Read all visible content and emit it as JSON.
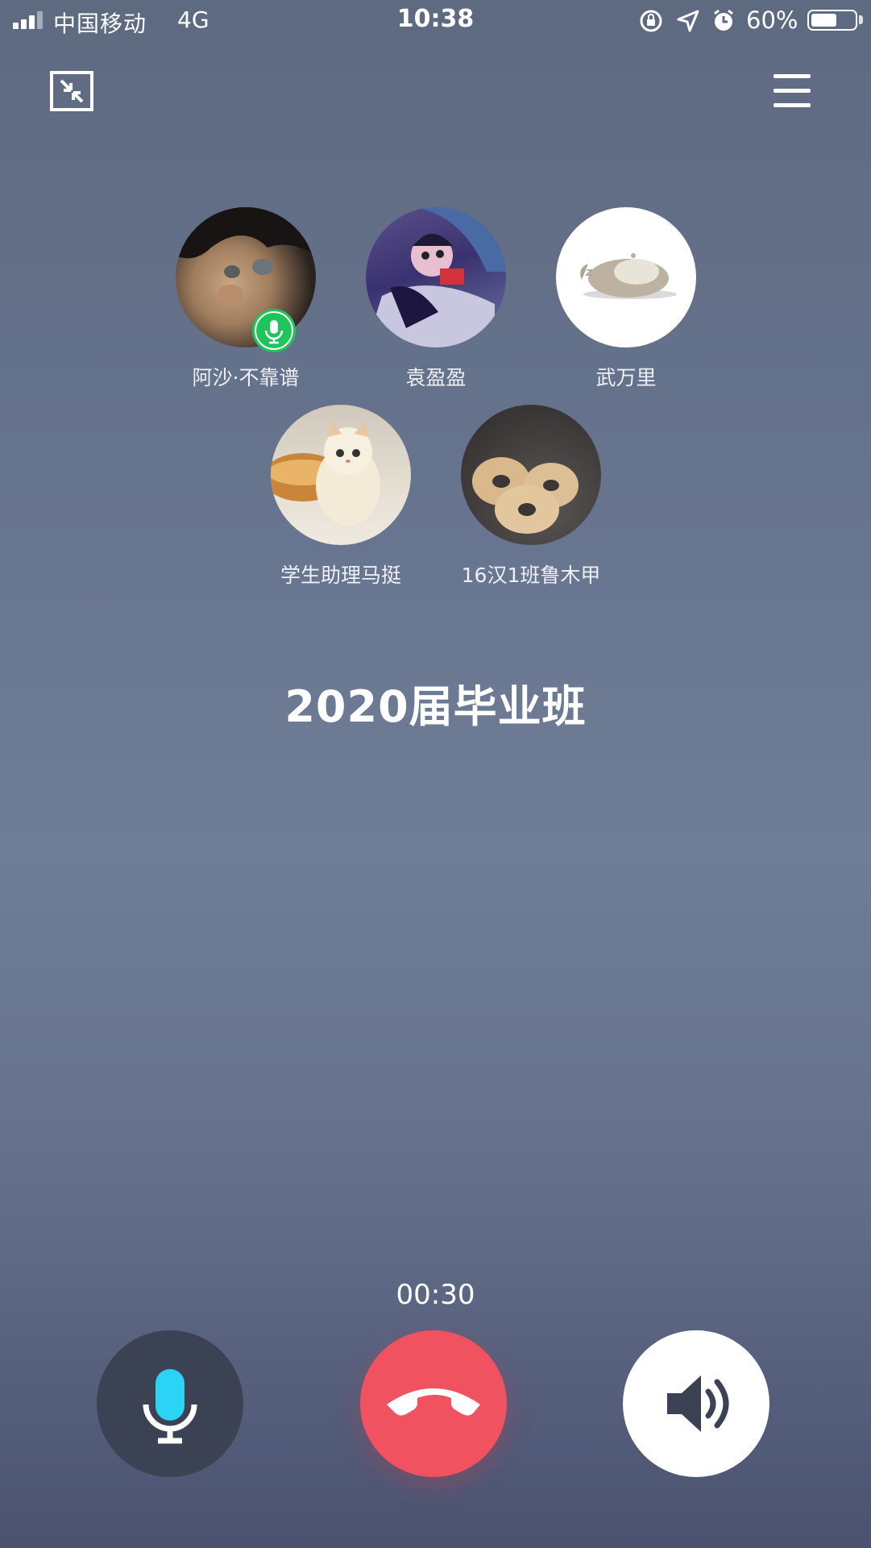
{
  "status_bar": {
    "carrier": "中国移动",
    "network": "4G",
    "time": "10:38",
    "battery_percent_label": "60%",
    "battery_level": 0.6,
    "icons": [
      "signal-icon",
      "orientation-lock-icon",
      "location-icon",
      "alarm-icon",
      "battery-icon"
    ]
  },
  "toolbar": {
    "minimize_icon": "minimize-icon",
    "menu_icon": "menu-icon"
  },
  "participants": [
    {
      "name": "阿沙·不靠谱",
      "speaking": true
    },
    {
      "name": "袁盈盈",
      "speaking": false
    },
    {
      "name": "武万里",
      "speaking": false
    },
    {
      "name": "学生助理马挺",
      "speaking": false
    },
    {
      "name": "16汉1班鲁木甲",
      "speaking": false
    }
  ],
  "group_name": "2020届毕业班",
  "call_duration": "00:30",
  "controls": {
    "mic_icon": "microphone-icon",
    "hangup_icon": "hang-up-icon",
    "speaker_icon": "speaker-icon"
  },
  "colors": {
    "hangup": "#f1525f",
    "mic_button": "#3b4254",
    "mic_accent": "#2bd3f5",
    "speaking_badge": "#1fc45b"
  }
}
